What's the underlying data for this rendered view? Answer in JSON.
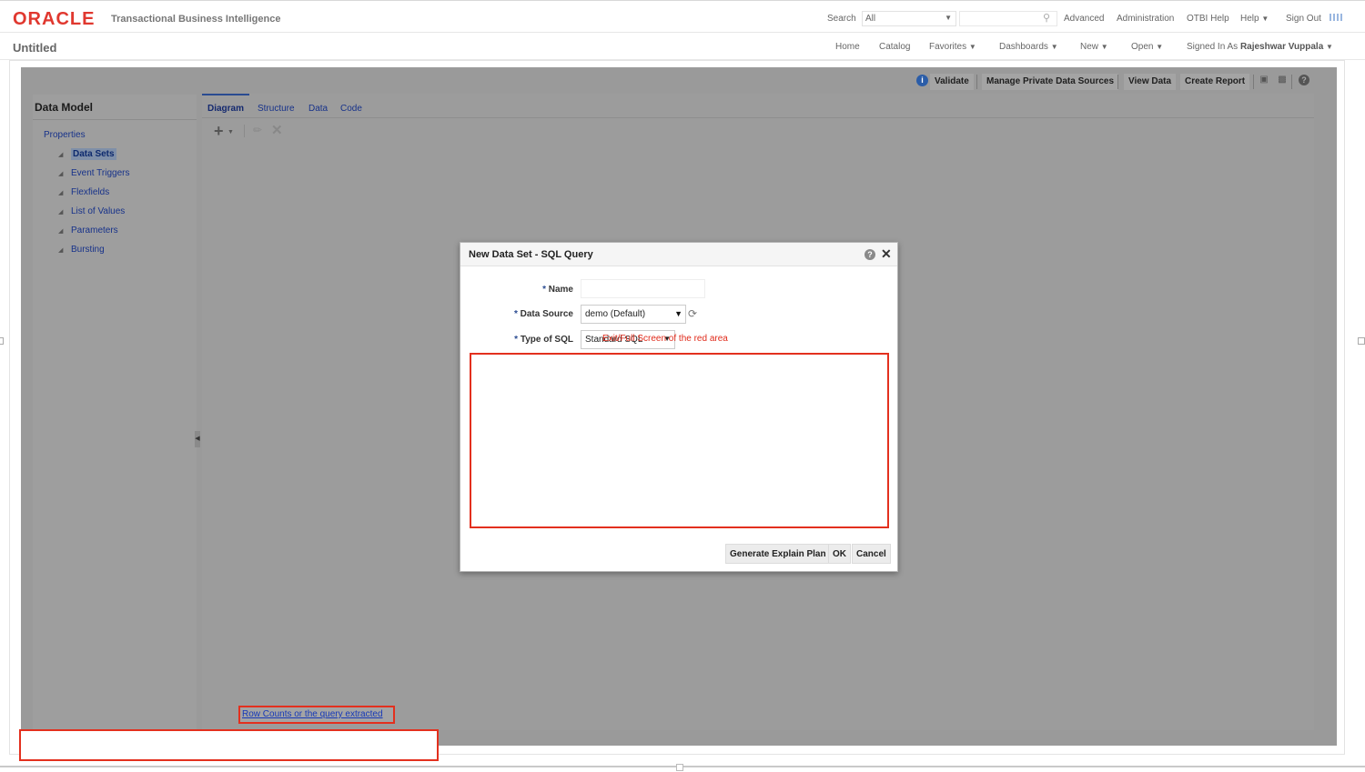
{
  "header": {
    "logo": "ORACLE",
    "product": "Transactional Business Intelligence",
    "search_label": "Search",
    "search_scope": "All",
    "links": [
      "Advanced",
      "Administration",
      "OTBI Help",
      "Help",
      "Sign Out"
    ]
  },
  "secondary": {
    "page_title": "Untitled",
    "nav": [
      "Home",
      "Catalog",
      "Favorites",
      "Dashboards",
      "New",
      "Open"
    ],
    "signed_in_label": "Signed In As",
    "user": "Rajeshwar Vuppala"
  },
  "toolbar": {
    "validate": "Validate",
    "manage_sources": "Manage Private Data Sources",
    "view_data": "View Data",
    "create_report": "Create Report"
  },
  "left_panel": {
    "title": "Data Model",
    "properties": "Properties",
    "items": [
      "Data Sets",
      "Event Triggers",
      "Flexfields",
      "List of Values",
      "Parameters",
      "Bursting"
    ]
  },
  "tabs": [
    "Diagram",
    "Structure",
    "Data",
    "Code"
  ],
  "annotations": {
    "row_counts": "Row Counts or the query extracted",
    "red_area": "Exit/Full Screen of the red area"
  },
  "dialog": {
    "title": "New Data Set - SQL Query",
    "name_label": "Name",
    "name_value": "",
    "data_source_label": "Data Source",
    "data_source_value": "demo (Default)",
    "sql_type_label": "Type of SQL",
    "sql_type_value": "Standard SQL",
    "required_mark": "*",
    "buttons": {
      "explain": "Generate Explain Plan",
      "ok": "OK",
      "cancel": "Cancel"
    }
  },
  "colors": {
    "oracle_red": "#e0382f",
    "link_blue": "#17328a",
    "annotation_red": "#e3301e"
  }
}
